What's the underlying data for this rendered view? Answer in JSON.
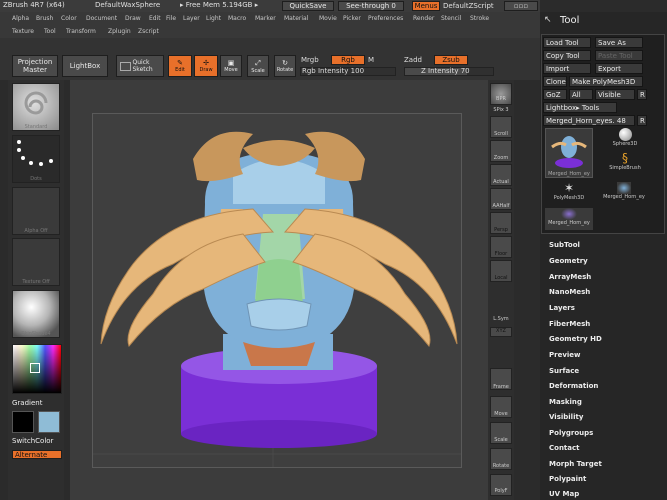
{
  "titlebar": {
    "items": [
      "ZBrush 4R7 (x64)",
      "DefaultWaxSphere",
      "▸ Free Mem 5.194GB ▸"
    ],
    "quicksave": "QuickSave",
    "seethrough": "See-through  0",
    "menus": "Menus",
    "script": "DefaultZScript"
  },
  "menubar": {
    "row1": [
      "Alpha",
      "Brush",
      "Color",
      "Document",
      "Draw",
      "Edit",
      "File",
      "Layer",
      "Light",
      "Macro",
      "Marker",
      "Material",
      "Movie",
      "Picker",
      "Preferences",
      "Render",
      "Stencil",
      "Stroke"
    ],
    "row2": [
      "Texture",
      "Tool",
      "Transform",
      "Zplugin",
      "Zscript"
    ]
  },
  "shelf": {
    "projection_master": "Projection Master",
    "lightbox": "LightBox",
    "quick_sketch": "Quick Sketch",
    "edit": "Edit",
    "draw": "Draw",
    "move": "Move",
    "scale": "Scale",
    "rotate": "Rotate",
    "mrgb": "Mrgb",
    "rgb": "Rgb",
    "m": "M",
    "rgb_intensity": "Rgb Intensity 100",
    "zadd": "Zadd",
    "zsub": "Zsub",
    "z_intensity": "Z Intensity 70"
  },
  "left": {
    "thumb_labels": [
      "Standard",
      "Dots",
      "Alpha Off",
      "Texture Off",
      "SkinShade4"
    ],
    "gradient": "Gradient",
    "switchcolor": "SwitchColor",
    "alternate": "Alternate"
  },
  "rightbar": {
    "items": [
      "BPR",
      "SPix 3",
      "Scroll",
      "Zoom",
      "Actual",
      "AAHalf",
      "Persp",
      "Floor",
      "Local",
      "L.Sym",
      "XYZ",
      "Frame",
      "Move",
      "Scale",
      "Rotate",
      "PolyF"
    ]
  },
  "toolpanel": {
    "title": "Tool",
    "load_tool": "Load Tool",
    "save_as": "Save As",
    "copy_tool": "Copy Tool",
    "paste_tool": "Paste Tool",
    "import": "Import",
    "export": "Export",
    "clone": "Clone",
    "make_polymesh": "Make PolyMesh3D",
    "goz": "GoZ",
    "all": "All",
    "visible": "Visible",
    "r": "R",
    "lightbox_tools": "Lightbox▸ Tools",
    "current_tool": "Merged_Horn_eyes. 48",
    "tool_thumbs": [
      "Merged_Horn_ey",
      "Sphere3D",
      "SimpleBrush",
      "PolyMesh3D",
      "Merged_Horn_ey",
      "Merged_Horn_ey"
    ],
    "subpalettes": [
      "SubTool",
      "Geometry",
      "ArrayMesh",
      "NanoMesh",
      "Layers",
      "FiberMesh",
      "Geometry HD",
      "Preview",
      "Surface",
      "Deformation",
      "Masking",
      "Visibility",
      "Polygroups",
      "Contact",
      "Morph Target",
      "Polypaint",
      "UV Map"
    ]
  },
  "colors": {
    "accent": "#e8702a",
    "mesh_blue": "#7fb0d8",
    "horn": "#e6b77a",
    "base_purple": "#7a2fd6"
  }
}
